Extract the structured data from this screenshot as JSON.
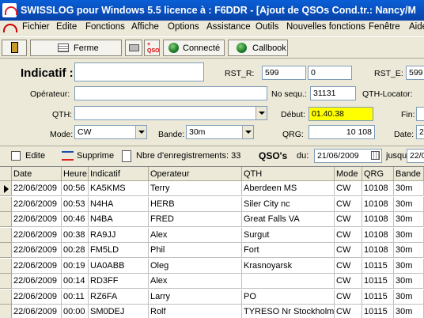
{
  "window": {
    "title": "SWISSLOG pour Windows 5.5 licence à : F6DDR - [Ajout de QSOs  Cond.tr.: Nancy/M"
  },
  "menu": [
    "Fichier",
    "Edite",
    "Fonctions",
    "Affiche",
    "Options",
    "Assistance",
    "Outils",
    "Nouvelles fonctions",
    "Fenêtre",
    "Aide"
  ],
  "toolbar": {
    "close_label": "Ferme",
    "connected_label": "Connecté",
    "callbook_label": "Callbook"
  },
  "form": {
    "indicatif_label": "Indicatif :",
    "indicatif_value": "",
    "rst_r_label": "RST_R:",
    "rst_r_value": "599",
    "rst_r_value2": "0",
    "rst_e_label": "RST_E:",
    "rst_e_value": "599",
    "operator_label": "Opérateur:",
    "operator_value": "",
    "no_sequ_label": "No sequ.:",
    "no_sequ_value": "31131",
    "qth_locator_label": "QTH-Locator:",
    "qth_label": "QTH:",
    "qth_value": "",
    "debut_label": "Début:",
    "debut_value": "01.40.38",
    "fin_label": "Fin:",
    "mode_label": "Mode:",
    "mode_value": "CW",
    "bande_label": "Bande:",
    "bande_value": "30m",
    "qrg_label": "QRG:",
    "qrg_value": "10 108",
    "date_label": "Date:",
    "date_value": "2"
  },
  "toolbar2": {
    "edit_label": "Edite",
    "delete_label": "Supprime",
    "count_label": "Nbre d'enregistrements: 33",
    "qsos_label": "QSO's",
    "du_label": "du:",
    "du_value": "21/06/2009",
    "jusqu_label": "jusqu",
    "jusqu_value": "22/0"
  },
  "table": {
    "columns": [
      "Date",
      "Heure",
      "Indicatif",
      "Operateur",
      "QTH",
      "Mode",
      "QRG",
      "Bande"
    ],
    "rows": [
      [
        "22/06/2009",
        "00:56",
        "KA5KMS",
        "Terry",
        "Aberdeen MS",
        "CW",
        "10108",
        "30m"
      ],
      [
        "22/06/2009",
        "00:53",
        "N4HA",
        "HERB",
        "Siler City nc",
        "CW",
        "10108",
        "30m"
      ],
      [
        "22/06/2009",
        "00:46",
        "N4BA",
        "FRED",
        "Great Falls VA",
        "CW",
        "10108",
        "30m"
      ],
      [
        "22/06/2009",
        "00:38",
        "RA9JJ",
        "Alex",
        "Surgut",
        "CW",
        "10108",
        "30m"
      ],
      [
        "22/06/2009",
        "00:28",
        "FM5LD",
        "Phil",
        "Fort",
        "CW",
        "10108",
        "30m"
      ],
      [
        "22/06/2009",
        "00:19",
        "UA0ABB",
        "Oleg",
        "Krasnoyarsk",
        "CW",
        "10115",
        "30m"
      ],
      [
        "22/06/2009",
        "00:14",
        "RD3FF",
        "Alex",
        "",
        "CW",
        "10115",
        "30m"
      ],
      [
        "22/06/2009",
        "00:11",
        "RZ6FA",
        "Larry",
        "PO",
        "CW",
        "10115",
        "30m"
      ],
      [
        "22/06/2009",
        "00:00",
        "SM0DEJ",
        "Rolf",
        "TYRESO  Nr Stockholm",
        "CW",
        "10115",
        "30m"
      ]
    ]
  }
}
